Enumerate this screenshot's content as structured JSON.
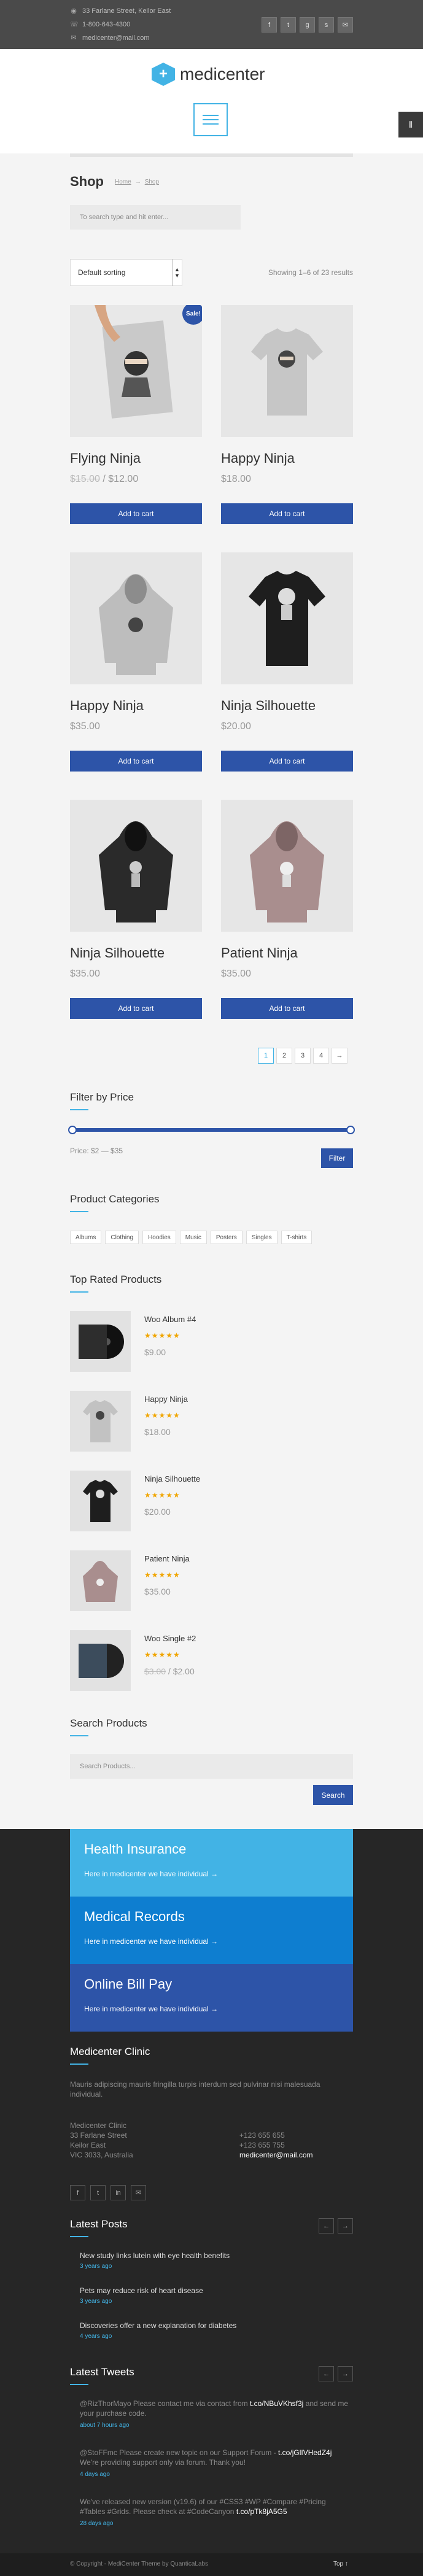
{
  "topbar": {
    "address": "33 Farlane Street, Keilor East",
    "phone": "1-800-643-4300",
    "email": "medicenter@mail.com",
    "socials": [
      "facebook-icon",
      "twitter-icon",
      "google-icon",
      "skype-icon",
      "mail-icon"
    ]
  },
  "header": {
    "logo_text": "medicenter"
  },
  "shop": {
    "title": "Shop",
    "breadcrumb": [
      "Home",
      "Shop"
    ],
    "search_placeholder": "To search type and hit enter...",
    "sort_selected": "Default sorting",
    "showing": "Showing 1–6 of 23 results",
    "add_to_cart": "Add to cart",
    "sale_label": "Sale!"
  },
  "products": [
    {
      "name": "Flying Ninja",
      "old_price": "$15.00",
      "price": "$12.00",
      "sale": true
    },
    {
      "name": "Happy Ninja",
      "price": "$18.00"
    },
    {
      "name": "Happy Ninja",
      "price": "$35.00"
    },
    {
      "name": "Ninja Silhouette",
      "price": "$20.00"
    },
    {
      "name": "Ninja Silhouette",
      "price": "$35.00"
    },
    {
      "name": "Patient Ninja",
      "price": "$35.00"
    }
  ],
  "pagination": [
    "1",
    "2",
    "3",
    "4",
    "→"
  ],
  "filter": {
    "title": "Filter by Price",
    "price_label": "Price: $2 — $35",
    "button": "Filter",
    "min_fraction": 0,
    "max_fraction": 1
  },
  "categories": {
    "title": "Product Categories",
    "items": [
      "Albums",
      "Clothing",
      "Hoodies",
      "Music",
      "Posters",
      "Singles",
      "T-shirts"
    ]
  },
  "top_rated": {
    "title": "Top Rated Products",
    "items": [
      {
        "name": "Woo Album #4",
        "price": "$9.00",
        "rating": 5
      },
      {
        "name": "Happy Ninja",
        "price": "$18.00",
        "rating": 5
      },
      {
        "name": "Ninja Silhouette",
        "price": "$20.00",
        "rating": 5
      },
      {
        "name": "Patient Ninja",
        "price": "$35.00",
        "rating": 5
      },
      {
        "name": "Woo Single #2",
        "old_price": "$3.00",
        "price": "$2.00",
        "rating": 5
      }
    ]
  },
  "search_products": {
    "title": "Search Products",
    "placeholder": "Search Products...",
    "button": "Search"
  },
  "footer": {
    "boxes": [
      {
        "title": "Health Insurance",
        "text": "Here in medicenter we have individual →",
        "color": "#42b3e5"
      },
      {
        "title": "Medical Records",
        "text": "Here in medicenter we have individual →",
        "color": "#0e7ed0"
      },
      {
        "title": "Online Bill Pay",
        "text": "Here in medicenter we have individual →",
        "color": "#2d54a8"
      }
    ],
    "clinic": {
      "title": "Medicenter Clinic",
      "desc": "Mauris adipiscing mauris fringilla turpis interdum sed pulvinar nisi malesuada individual.",
      "name": "Medicenter Clinic",
      "street": "33 Farlane Street",
      "city": "Keilor East",
      "state": "VIC 3033, Australia",
      "phone1": "+123 655 655",
      "phone2": "+123 655 755",
      "email": "medicenter@mail.com"
    },
    "socials": [
      "facebook-icon",
      "twitter-icon",
      "linkedin-icon",
      "mail-icon"
    ],
    "latest_posts": {
      "title": "Latest Posts",
      "items": [
        {
          "text": "New study links lutein with eye health benefits",
          "date": "3 years ago"
        },
        {
          "text": "Pets may reduce risk of heart disease",
          "date": "3 years ago"
        },
        {
          "text": "Discoveries offer a new explanation for diabetes",
          "date": "4 years ago"
        }
      ]
    },
    "latest_tweets": {
      "title": "Latest Tweets",
      "items": [
        {
          "user": "@RizThorMayo",
          "text": "Please contact me via contact from",
          "link": "t.co/NBuVKhsf3j",
          "rest": "and send me your purchase code.",
          "date": "about 7 hours ago"
        },
        {
          "user": "@StoFFmc",
          "text": "Please create new topic on our Support Forum -",
          "link": "t.co/jGlIVHedZ4j",
          "rest": "We're providing support only via forum. Thank you!",
          "date": "4 days ago"
        },
        {
          "user": "",
          "text": "We've released new version (v19.6) of our #CSS3 #WP #Compare #Pricing #Tables #Grids. Please check at #CodeCanyon",
          "link": "t.co/pTk8jA5G5",
          "rest": "",
          "date": "28 days ago"
        }
      ]
    },
    "copyright": "© Copyright - MediCenter Theme by QuanticaLabs",
    "top_link": "Top ↑"
  }
}
